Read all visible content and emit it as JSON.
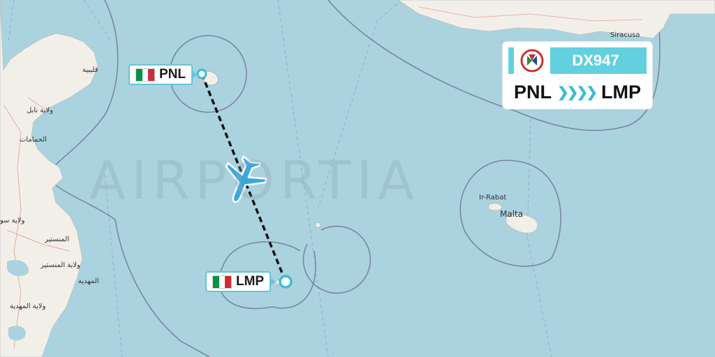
{
  "watermark": "AIRPORTIA",
  "flight": {
    "number": "DX947",
    "origin": "PNL",
    "destination": "LMP",
    "arrows": "❯❯❯❯",
    "logo_icon": "airline-logo-icon"
  },
  "airports": {
    "origin": {
      "code": "PNL",
      "flag": "italy-flag-icon",
      "flag_colors": [
        "#009246",
        "#ffffff",
        "#ce2b37"
      ]
    },
    "destination": {
      "code": "LMP",
      "flag": "italy-flag-icon",
      "flag_colors": [
        "#009246",
        "#ffffff",
        "#ce2b37"
      ]
    }
  },
  "places": {
    "syracuse": "Siracusa",
    "malta": "Malta",
    "ir_rabat": "Ir-Rabat",
    "t1": "قليبية",
    "t2": "ولاية نابل",
    "t3": "الحمامات",
    "t4": "المنستير",
    "t5": "ولاية المنستير",
    "t6": "المهدية",
    "t7": "ولاية المهدية",
    "t8": "ولاية سو"
  },
  "colors": {
    "sea": "#aad3df",
    "land": "#f2efe9",
    "accent": "#62d0df",
    "route": "#111111",
    "plane": "#3aa8dd"
  }
}
